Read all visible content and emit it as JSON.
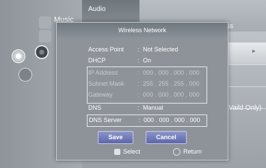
{
  "background": {
    "left_menu": "Music",
    "tab_title": "Audio",
    "right_header_partial": "ss",
    "right_row_partial": "(Vaild Only)",
    "arrow": "▸"
  },
  "dialog": {
    "title": "Wireless Network",
    "rows": [
      {
        "label": "Access Point",
        "sep": ":",
        "value": "Not Selected"
      },
      {
        "label": "DHCP",
        "sep": ":",
        "value": "On"
      },
      {
        "label": "IP Address",
        "sep": ":",
        "value": "000 . 000 . 000 . 000"
      },
      {
        "label": "Subnet Mask",
        "sep": ":",
        "value": "255 . 255 . 255 . 000"
      },
      {
        "label": "Gateway",
        "sep": ":",
        "value": "000 . 000 . 000 . 000"
      },
      {
        "label": "DNS",
        "sep": ":",
        "value": "Manual"
      },
      {
        "label": "DNS Server",
        "sep": ":",
        "value": "000 . 000 . 000 . 000"
      }
    ],
    "buttons": {
      "save": "Save",
      "cancel": "Cancel"
    },
    "hints": {
      "select": "Select",
      "return": "Return"
    }
  }
}
